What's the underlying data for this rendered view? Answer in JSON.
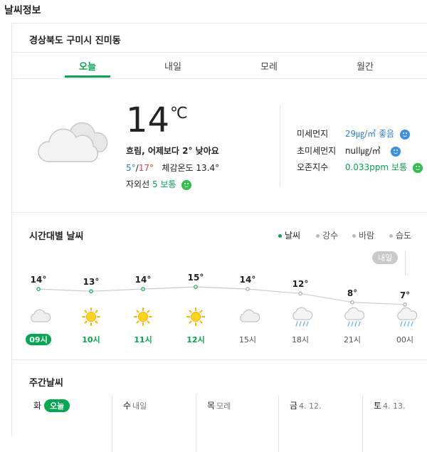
{
  "page_title": "날씨정보",
  "location": "경상북도 구미시 진미동",
  "tabs": [
    "오늘",
    "내일",
    "모레",
    "월간"
  ],
  "current": {
    "temp": "14",
    "unit": "℃",
    "summary": "흐림, 어제보다 2° 낮아요",
    "min": "5°",
    "sep": "/",
    "max": "17°",
    "feels_label": "체감온도",
    "feels": "13.4°",
    "uv_label": "자외선",
    "uv_value": "5 보통"
  },
  "air": [
    {
      "label": "미세먼지",
      "value": "29㎍/㎥ 좋음",
      "color": "#2b7fd8",
      "face": "blue"
    },
    {
      "label": "초미세먼지",
      "value": "null㎍/㎥",
      "color": "#222222",
      "face": "blue"
    },
    {
      "label": "오존지수",
      "value": "0.033ppm 보통",
      "color": "#03a94f",
      "face": "green"
    }
  ],
  "hourly_title": "시간대별 날씨",
  "legend": [
    "날씨",
    "강수",
    "바람",
    "습도"
  ],
  "tomorrow_badge": "내일",
  "hourly": [
    {
      "time": "09시",
      "temp": "14°",
      "t": 14,
      "icon": "cloud-icon",
      "style": "now"
    },
    {
      "time": "10시",
      "temp": "13°",
      "t": 13,
      "icon": "sun-icon",
      "style": "green"
    },
    {
      "time": "11시",
      "temp": "14°",
      "t": 14,
      "icon": "sun-icon",
      "style": "green"
    },
    {
      "time": "12시",
      "temp": "15°",
      "t": 15,
      "icon": "sun-icon",
      "style": "green"
    },
    {
      "time": "15시",
      "temp": "14°",
      "t": 14,
      "icon": "cloud-icon",
      "style": "grey"
    },
    {
      "time": "18시",
      "temp": "12°",
      "t": 12,
      "icon": "rain-cloud-icon",
      "style": "grey"
    },
    {
      "time": "21시",
      "temp": "8°",
      "t": 8,
      "icon": "rain-cloud-icon",
      "style": "grey"
    },
    {
      "time": "00시",
      "temp": "7°",
      "t": 7,
      "icon": "rain-cloud-icon",
      "style": "grey"
    }
  ],
  "weekly_title": "주간날씨",
  "weekly": [
    {
      "day": "화",
      "sub": "오늘",
      "pill": true
    },
    {
      "day": "수",
      "sub": "내일",
      "pill": false
    },
    {
      "day": "목",
      "sub": "모레",
      "pill": false
    },
    {
      "day": "금",
      "sub": "4. 12.",
      "pill": false
    },
    {
      "day": "토",
      "sub": "4. 13.",
      "pill": false
    }
  ],
  "colors": {
    "accent": "#03a94f",
    "min": "#2b7fd8",
    "max": "#e03e3e"
  }
}
